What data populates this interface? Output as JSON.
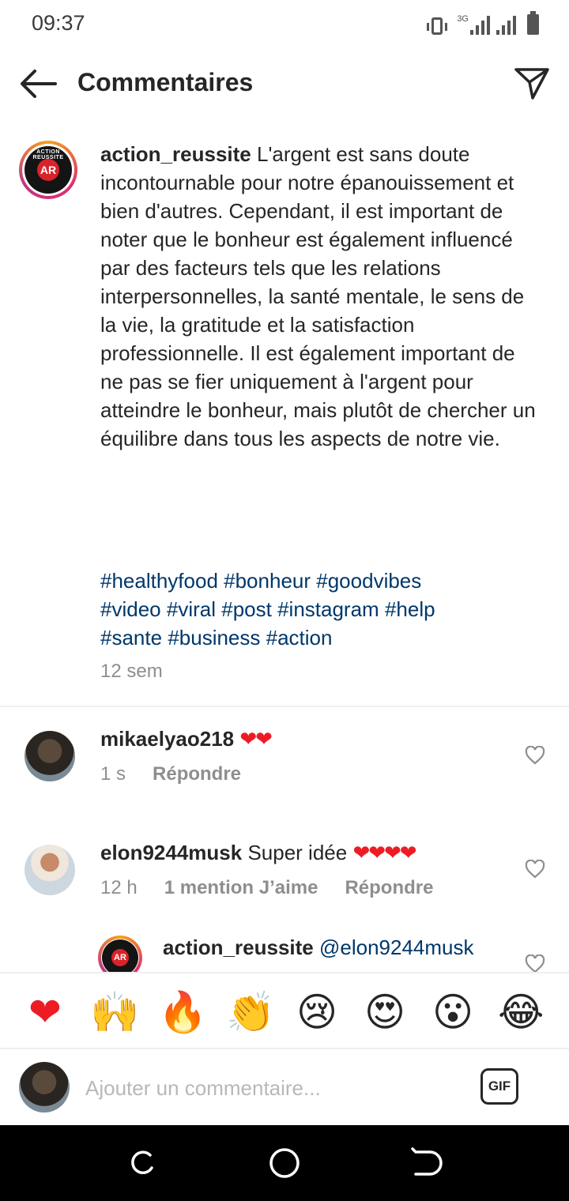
{
  "status": {
    "time": "09:37",
    "network": "3G"
  },
  "header": {
    "title": "Commentaires",
    "back_icon": "arrow-left-icon",
    "share_icon": "paper-plane-icon"
  },
  "post": {
    "username": "action_reussite",
    "caption": "L'argent est sans doute incontournable pour notre épanouissement et bien d'autres. Cependant, il est important de noter que le bonheur est également influencé par des facteurs tels que les relations interpersonnelles, la santé mentale, le sens de la vie, la gratitude et la satisfaction professionnelle. Il est également important de ne pas se fier uniquement à l'argent pour atteindre le bonheur, mais plutôt de chercher un équilibre dans tous les aspects de notre vie.",
    "hashtags": [
      "#healthyfood",
      "#bonheur",
      "#goodvibes",
      "#video",
      "#viral",
      "#post",
      "#instagram",
      "#help",
      "#sante",
      "#business",
      "#action"
    ],
    "time": "12 sem",
    "logo_text": "AR"
  },
  "comments": [
    {
      "username": "mikaelyao218",
      "text": "",
      "emoji": "❤❤",
      "time": "1 s",
      "likes": "",
      "reply_label": "Répondre"
    },
    {
      "username": "elon9244musk",
      "text": "Super idée",
      "emoji": "❤❤❤❤",
      "time": "12 h",
      "likes": "1 mention J’aime",
      "reply_label": "Répondre"
    },
    {
      "username": "action_reussite",
      "mention": "@elon9244musk"
    }
  ],
  "reactions": [
    "❤",
    "🙌",
    "🔥",
    "👏",
    "😢",
    "😍",
    "😮",
    "😂"
  ],
  "composer": {
    "placeholder": "Ajouter un commentaire...",
    "gif_label": "GIF"
  },
  "colors": {
    "link": "#00376b",
    "muted": "#8e8e8e",
    "heart": "#ed1c24"
  }
}
